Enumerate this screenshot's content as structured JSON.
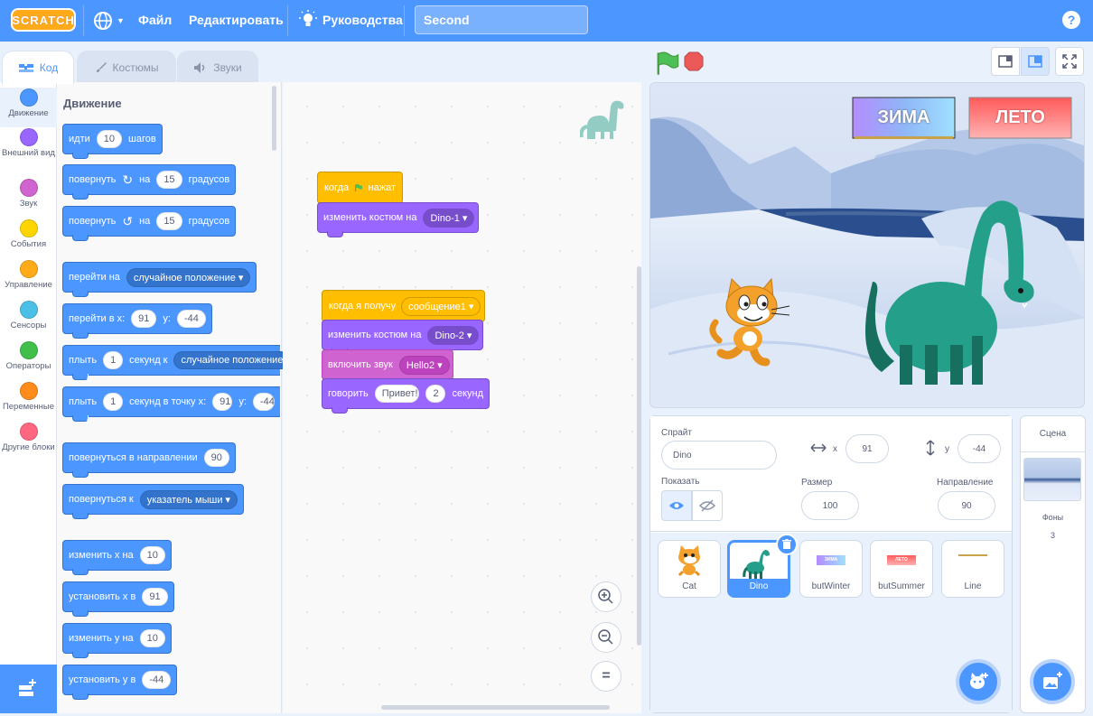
{
  "menubar": {
    "logo": "SCRATCH",
    "file": "Файл",
    "edit": "Редактировать",
    "tutorials": "Руководства",
    "project_title": "Second",
    "help": "?"
  },
  "tabs": {
    "code": "Код",
    "costumes": "Костюмы",
    "sounds": "Звуки"
  },
  "categories": [
    {
      "label": "Движение",
      "color": "#4c97ff"
    },
    {
      "label": "Внешний вид",
      "color": "#9966ff"
    },
    {
      "label": "Звук",
      "color": "#cf63cf"
    },
    {
      "label": "События",
      "color": "#ffd500"
    },
    {
      "label": "Управление",
      "color": "#ffab19"
    },
    {
      "label": "Сенсоры",
      "color": "#4cbfe6"
    },
    {
      "label": "Операторы",
      "color": "#40bf4a"
    },
    {
      "label": "Переменные",
      "color": "#ff8c1a"
    },
    {
      "label": "Другие блоки",
      "color": "#ff6680"
    }
  ],
  "palette": {
    "title": "Движение",
    "move": {
      "a": "идти",
      "v": "10",
      "b": "шагов"
    },
    "turn_right": {
      "a": "повернуть",
      "b": "на",
      "v": "15",
      "c": "градусов"
    },
    "turn_left": {
      "a": "повернуть",
      "b": "на",
      "v": "15",
      "c": "градусов"
    },
    "goto": {
      "a": "перейти на",
      "dd": "случайное положение"
    },
    "goto_xy": {
      "a": "перейти в x:",
      "x": "91",
      "b": "y:",
      "y": "-44"
    },
    "glide": {
      "a": "плыть",
      "v": "1",
      "b": "секунд к",
      "dd": "случайное положение"
    },
    "glide_xy": {
      "a": "плыть",
      "v": "1",
      "b": "секунд в точку x:",
      "x": "91",
      "c": "y:",
      "y": "-44"
    },
    "point_dir": {
      "a": "повернуться в направлении",
      "v": "90"
    },
    "point_to": {
      "a": "повернуться к",
      "dd": "указатель мыши"
    },
    "change_x": {
      "a": "изменить х на",
      "v": "10"
    },
    "set_x": {
      "a": "установить х в",
      "v": "91"
    },
    "change_y": {
      "a": "изменить у на",
      "v": "10"
    },
    "set_y": {
      "a": "установить у в",
      "v": "-44"
    }
  },
  "scripts": {
    "s1_hat": {
      "a": "когда",
      "b": "нажат"
    },
    "s1_costume": {
      "a": "изменить костюм на",
      "dd": "Dino-1"
    },
    "s2_hat": {
      "a": "когда я получу",
      "dd": "сообщение1"
    },
    "s2_costume": {
      "a": "изменить костюм на",
      "dd": "Dino-2"
    },
    "s2_sound": {
      "a": "включить звук",
      "dd": "Hello2"
    },
    "s2_say": {
      "a": "говорить",
      "v": "Привет!",
      "v2": "2",
      "b": "секунд"
    }
  },
  "stage": {
    "btn_winter": "ЗИМА",
    "btn_summer": "ЛЕТО"
  },
  "sprite_info": {
    "sprite_label": "Спрайт",
    "sprite_name": "Dino",
    "x_label": "x",
    "x": "91",
    "y_label": "y",
    "y": "-44",
    "show_label": "Показать",
    "size_label": "Размер",
    "size": "100",
    "direction_label": "Направление",
    "direction": "90"
  },
  "sprites": [
    {
      "name": "Cat"
    },
    {
      "name": "Dino"
    },
    {
      "name": "butWinter",
      "thumb": "ЗИМА"
    },
    {
      "name": "butSummer",
      "thumb": "ЛЕТО"
    },
    {
      "name": "Line"
    }
  ],
  "stage_pane": {
    "title": "Сцена",
    "backdrops_label": "Фоны",
    "backdrops_count": "3"
  }
}
